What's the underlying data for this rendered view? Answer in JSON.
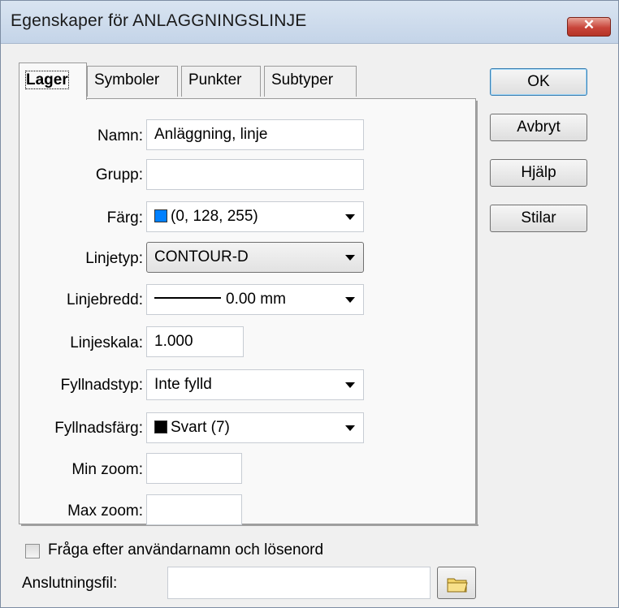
{
  "window": {
    "title": "Egenskaper för ANLAGGNINGSLINJE",
    "close_label": "✕"
  },
  "tabs": [
    {
      "label": "Lager",
      "active": true
    },
    {
      "label": "Symboler",
      "active": false
    },
    {
      "label": "Punkter",
      "active": false
    },
    {
      "label": "Subtyper",
      "active": false
    }
  ],
  "form": {
    "namn": {
      "label": "Namn:",
      "value": "Anläggning, linje"
    },
    "grupp": {
      "label": "Grupp:",
      "value": ""
    },
    "farg": {
      "label": "Färg:",
      "value": "(0, 128, 255)",
      "swatch_color": "#0080ff"
    },
    "linjetyp": {
      "label": "Linjetyp:",
      "value": "CONTOUR-D"
    },
    "linjebredd": {
      "label": "Linjebredd:",
      "value": "0.00 mm"
    },
    "linjeskala": {
      "label": "Linjeskala:",
      "value": "1.000"
    },
    "fyllnadstyp": {
      "label": "Fyllnadstyp:",
      "value": "Inte fylld"
    },
    "fyllnadsfarg": {
      "label": "Fyllnadsfärg:",
      "value": "Svart (7)",
      "swatch_color": "#000000"
    },
    "min_zoom": {
      "label": "Min zoom:",
      "value": ""
    },
    "max_zoom": {
      "label": "Max zoom:",
      "value": ""
    }
  },
  "buttons": {
    "ok": "OK",
    "avbryt": "Avbryt",
    "hjalp": "Hjälp",
    "stilar": "Stilar"
  },
  "footer": {
    "checkbox_label": "Fråga efter användarnamn och lösenord",
    "checkbox_checked": false,
    "anslutningsfil_label": "Anslutningsfil:",
    "anslutningsfil_value": ""
  },
  "colors": {
    "accent_blue": "#0080ff",
    "close_red": "#c8453a"
  }
}
